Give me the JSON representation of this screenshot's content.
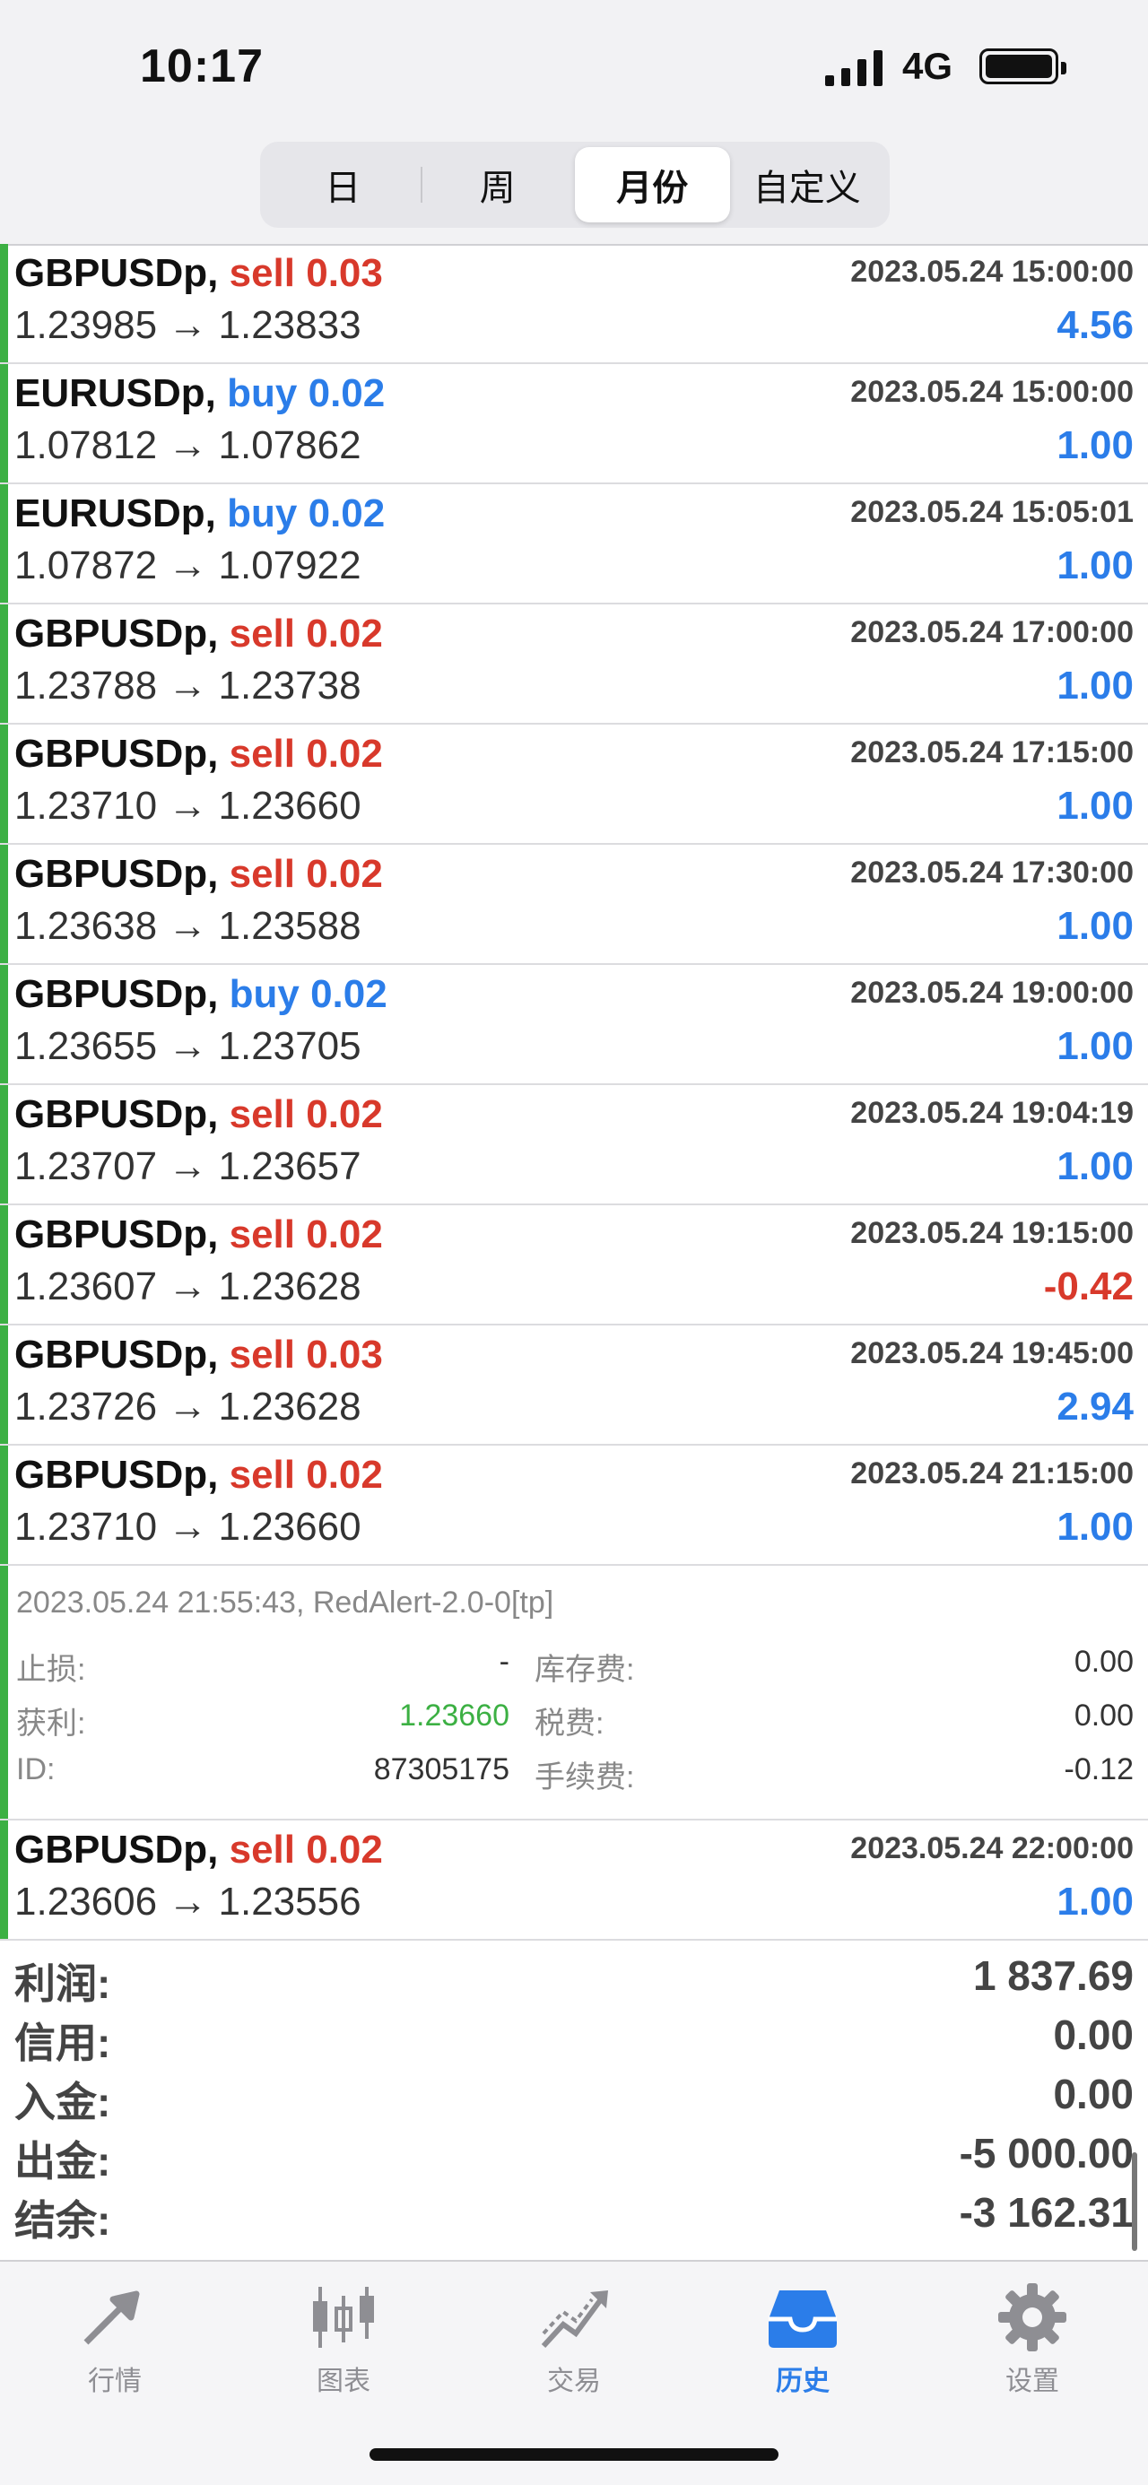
{
  "status_bar": {
    "time": "10:17",
    "network": "4G"
  },
  "period_tabs": [
    {
      "label": "日",
      "active": false
    },
    {
      "label": "周",
      "active": false
    },
    {
      "label": "月份",
      "active": true
    },
    {
      "label": "自定义",
      "active": false
    }
  ],
  "deals": [
    {
      "symbol": "GBPUSDp,",
      "side": "sell",
      "side_class": "sell",
      "volume": "0.03",
      "datetime": "2023.05.24 15:00:00",
      "prices": "1.23985 → 1.23833",
      "profit": "4.56",
      "profit_class": "pos"
    },
    {
      "symbol": "EURUSDp,",
      "side": "buy",
      "side_class": "buy",
      "volume": "0.02",
      "datetime": "2023.05.24 15:00:00",
      "prices": "1.07812 → 1.07862",
      "profit": "1.00",
      "profit_class": "pos"
    },
    {
      "symbol": "EURUSDp,",
      "side": "buy",
      "side_class": "buy",
      "volume": "0.02",
      "datetime": "2023.05.24 15:05:01",
      "prices": "1.07872 → 1.07922",
      "profit": "1.00",
      "profit_class": "pos"
    },
    {
      "symbol": "GBPUSDp,",
      "side": "sell",
      "side_class": "sell",
      "volume": "0.02",
      "datetime": "2023.05.24 17:00:00",
      "prices": "1.23788 → 1.23738",
      "profit": "1.00",
      "profit_class": "pos"
    },
    {
      "symbol": "GBPUSDp,",
      "side": "sell",
      "side_class": "sell",
      "volume": "0.02",
      "datetime": "2023.05.24 17:15:00",
      "prices": "1.23710 → 1.23660",
      "profit": "1.00",
      "profit_class": "pos"
    },
    {
      "symbol": "GBPUSDp,",
      "side": "sell",
      "side_class": "sell",
      "volume": "0.02",
      "datetime": "2023.05.24 17:30:00",
      "prices": "1.23638 → 1.23588",
      "profit": "1.00",
      "profit_class": "pos"
    },
    {
      "symbol": "GBPUSDp,",
      "side": "buy",
      "side_class": "buy",
      "volume": "0.02",
      "datetime": "2023.05.24 19:00:00",
      "prices": "1.23655 → 1.23705",
      "profit": "1.00",
      "profit_class": "pos"
    },
    {
      "symbol": "GBPUSDp,",
      "side": "sell",
      "side_class": "sell",
      "volume": "0.02",
      "datetime": "2023.05.24 19:04:19",
      "prices": "1.23707 → 1.23657",
      "profit": "1.00",
      "profit_class": "pos"
    },
    {
      "symbol": "GBPUSDp,",
      "side": "sell",
      "side_class": "sell",
      "volume": "0.02",
      "datetime": "2023.05.24 19:15:00",
      "prices": "1.23607 → 1.23628",
      "profit": "-0.42",
      "profit_class": "neg"
    },
    {
      "symbol": "GBPUSDp,",
      "side": "sell",
      "side_class": "sell",
      "volume": "0.03",
      "datetime": "2023.05.24 19:45:00",
      "prices": "1.23726 → 1.23628",
      "profit": "2.94",
      "profit_class": "pos"
    },
    {
      "symbol": "GBPUSDp,",
      "side": "sell",
      "side_class": "sell",
      "volume": "0.02",
      "datetime": "2023.05.24 21:15:00",
      "prices": "1.23710 → 1.23660",
      "profit": "1.00",
      "profit_class": "pos"
    }
  ],
  "expanded_detail": {
    "comment": "2023.05.24 21:55:43, RedAlert-2.0-0[tp]",
    "sl_label": "止损:",
    "sl_value": "-",
    "tp_label": "获利:",
    "tp_value": "1.23660",
    "id_label": "ID:",
    "id_value": "87305175",
    "swap_label": "库存费:",
    "swap_value": "0.00",
    "tax_label": "税费:",
    "tax_value": "0.00",
    "fee_label": "手续费:",
    "fee_value": "-0.12"
  },
  "last_deal": {
    "symbol": "GBPUSDp,",
    "side": "sell",
    "side_class": "sell",
    "volume": "0.02",
    "datetime": "2023.05.24 22:00:00",
    "prices": "1.23606 → 1.23556",
    "profit": "1.00",
    "profit_class": "pos"
  },
  "summary": [
    {
      "label": "利润:",
      "value": "1 837.69"
    },
    {
      "label": "信用:",
      "value": "0.00"
    },
    {
      "label": "入金:",
      "value": "0.00"
    },
    {
      "label": "出金:",
      "value": "-5 000.00"
    },
    {
      "label": "结余:",
      "value": "-3 162.31"
    }
  ],
  "tab_bar": [
    {
      "label": "行情",
      "icon": "quotes-icon",
      "active": false
    },
    {
      "label": "图表",
      "icon": "chart-icon",
      "active": false
    },
    {
      "label": "交易",
      "icon": "trade-icon",
      "active": false
    },
    {
      "label": "历史",
      "icon": "history-icon",
      "active": true
    },
    {
      "label": "设置",
      "icon": "gear-icon",
      "active": false
    }
  ],
  "colors": {
    "sell": "#d8392b",
    "buy": "#2b7de9",
    "accent_green": "#3cb043",
    "active_tab": "#2b7de9"
  }
}
